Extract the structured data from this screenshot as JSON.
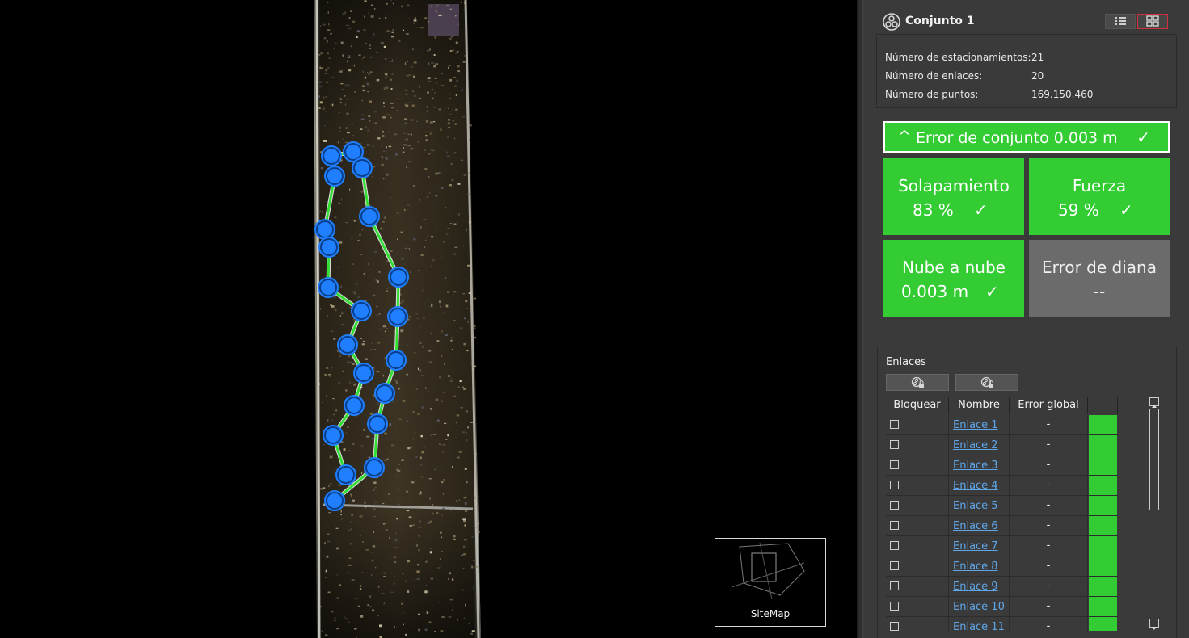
{
  "viewport": {
    "minimap_label": "SiteMap"
  },
  "panel": {
    "group_title": "Conjunto 1",
    "group_icon": "cluster-icon",
    "view_buttons": [
      {
        "name": "list-view",
        "icon": "list-icon",
        "selected": false
      },
      {
        "name": "grid-view",
        "icon": "grid-icon",
        "selected": true
      }
    ],
    "stats": [
      {
        "label": "Número de estacionamientos:",
        "value": "21"
      },
      {
        "label": "Número de enlaces:",
        "value": "20"
      },
      {
        "label": "Número de puntos:",
        "value": "169.150.460"
      }
    ],
    "set_error": {
      "chevron": "^",
      "label": "Error de conjunto 0.003 m",
      "check": "✓",
      "color": "#33cc33"
    },
    "tiles": [
      {
        "title": "Solapamiento",
        "value": "83 %",
        "check": "✓",
        "status": "ok"
      },
      {
        "title": "Fuerza",
        "value": "59 %",
        "check": "✓",
        "status": "ok"
      },
      {
        "title": "Nube a nube",
        "value": "0.003 m",
        "check": "✓",
        "status": "ok"
      },
      {
        "title": "Error de diana",
        "value": "--",
        "check": "",
        "status": "none"
      }
    ],
    "links": {
      "title": "Enlaces",
      "buttons": [
        {
          "name": "lock-links",
          "icon": "lock-cluster-icon"
        },
        {
          "name": "unlock-links",
          "icon": "unlock-cluster-icon"
        }
      ],
      "columns": [
        "Bloquear",
        "Nombre",
        "Error global",
        ""
      ],
      "rows": [
        {
          "locked": false,
          "name": "Enlace 1",
          "error": "-",
          "status_color": "#33cc33"
        },
        {
          "locked": false,
          "name": "Enlace 2",
          "error": "-",
          "status_color": "#33cc33"
        },
        {
          "locked": false,
          "name": "Enlace 3",
          "error": "-",
          "status_color": "#33cc33"
        },
        {
          "locked": false,
          "name": "Enlace 4",
          "error": "-",
          "status_color": "#33cc33"
        },
        {
          "locked": false,
          "name": "Enlace 5",
          "error": "-",
          "status_color": "#33cc33"
        },
        {
          "locked": false,
          "name": "Enlace 6",
          "error": "-",
          "status_color": "#33cc33"
        },
        {
          "locked": false,
          "name": "Enlace 7",
          "error": "-",
          "status_color": "#33cc33"
        },
        {
          "locked": false,
          "name": "Enlace 8",
          "error": "-",
          "status_color": "#33cc33"
        },
        {
          "locked": false,
          "name": "Enlace 9",
          "error": "-",
          "status_color": "#33cc33"
        },
        {
          "locked": false,
          "name": "Enlace 10",
          "error": "-",
          "status_color": "#33cc33"
        },
        {
          "locked": false,
          "name": "Enlace 11",
          "error": "-",
          "status_color": "#33cc33"
        }
      ]
    }
  },
  "colors": {
    "ok": "#33cc33",
    "neutral": "#6b6b6b",
    "station": "#1f7fff",
    "link_line": "#33dd33",
    "accent_border": "#d0303b"
  }
}
